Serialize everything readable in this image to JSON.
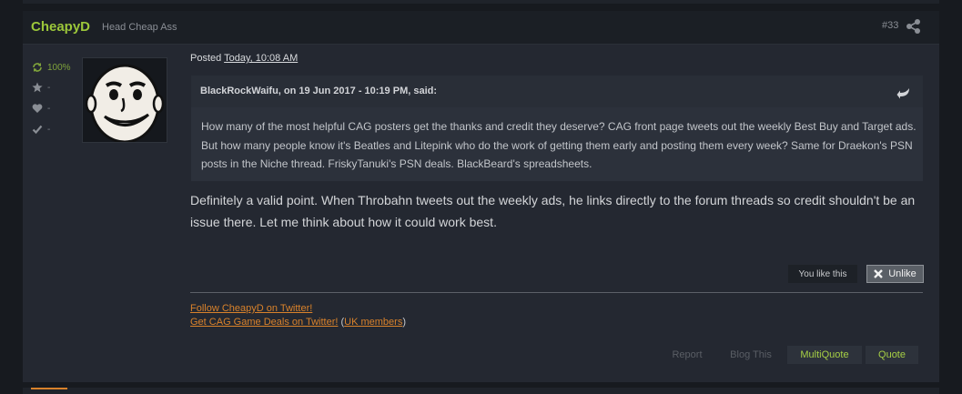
{
  "post": {
    "author": "CheapyD",
    "author_title": "Head Cheap Ass",
    "number": "#33",
    "reputation": "100%",
    "stats": [
      "-",
      "-",
      "-"
    ],
    "posted_label": "Posted",
    "posted_date": "Today, 10:08 AM",
    "quote": {
      "header": "BlackRockWaifu, on 19 Jun 2017 - 10:19 PM, said:",
      "text": "How many of the most helpful CAG posters get the thanks and credit they deserve? CAG front page tweets out the weekly Best Buy and Target ads. But how many people know it's Beatles and Litepink who do the work of getting them early and posting them every week? Same for Draekon's PSN posts in the Niche thread. FriskyTanuki's PSN deals. BlackBeard's spreadsheets."
    },
    "body": "Definitely a valid point.  When Throbahn tweets out the weekly ads, he links directly to the forum threads so credit shouldn't be an issue there.  Let me think about how it could work best.",
    "like_status": "You like this",
    "unlike_label": "Unlike",
    "signature": {
      "line1": "Follow CheapyD on Twitter!",
      "line2_link": "Get CAG Game Deals on Twitter!",
      "line2_paren_open": " (",
      "line2_uk": "UK members",
      "line2_paren_close": ")"
    },
    "actions": {
      "report": "Report",
      "blog": "Blog This",
      "multiquote": "MultiQuote",
      "quote": "Quote"
    }
  },
  "colors": {
    "accent_green": "#9cc73a",
    "link_orange": "#d9822b",
    "background": "#171a1f",
    "post_background": "#242831"
  },
  "icons": [
    "share-icon",
    "refresh-icon",
    "star-icon",
    "heart-icon",
    "check-icon",
    "quote-arrow-icon",
    "close-icon"
  ]
}
